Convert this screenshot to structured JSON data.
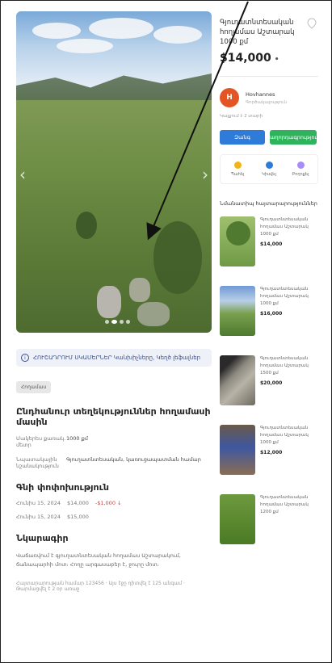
{
  "listing": {
    "title": "Գյուղատնտեսական հողամաս Աշտարակ 1000 քմ",
    "price": "$14,000",
    "price_suffix": "•",
    "notice": "ՀՈՒՇԱԴՐՈՒՄ ՍԿԱՄԵՐՆԵՐ Կանխիչները, Կեղծ լեֆալներ",
    "tag": "Հողամաս",
    "section_title": "Ընդհանուր տեղեկություններ հողամասի մասին",
    "details": [
      {
        "k": "Մակերես քառակ. մետր",
        "v": "1000 քմ"
      },
      {
        "k": "Նպատակային նշանակություն",
        "v": "Գյուղատնտեսական, կառուցապատման համար"
      }
    ],
    "price_history_title": "Գնի փոփոխություն",
    "price_history": [
      {
        "date": "Հունիս 15, 2024",
        "price": "$14,000",
        "change": "-$1,000 ↓"
      },
      {
        "date": "Հունիս 15, 2024",
        "price": "$15,000",
        "change": ""
      }
    ],
    "description_title": "Նկարագիր",
    "description": "Վաճառվում է գյուղատնտեսական հողամաս Աշտարակում, ճանապարհի մոտ։ Հողը արգասաբեր է, ջուրը մոտ։",
    "meta": "Հայտարարության համար 123456 · Այս էջը դիտվել է 125 անգամ · Թարմացվել է 2 օր առաջ"
  },
  "seller": {
    "initial": "H",
    "name": "Hovhannes",
    "subtitle": "Գործակալություն",
    "since": "Կայքում է 2 տարի"
  },
  "buttons": {
    "call": "Զանգ",
    "message": "Հաղորդագրություն"
  },
  "actions": [
    {
      "label": "Պահել",
      "color": "#f2b418"
    },
    {
      "label": "Կիսվել",
      "color": "#2f7bd9"
    },
    {
      "label": "Բողոքել",
      "color": "#a78bfa"
    }
  ],
  "similar": {
    "heading": "Նմանատիպ հայտարարություններ",
    "items": [
      {
        "title": "Գյուղատնտեսական հողամաս Աշտարակ 1000 քմ",
        "price": "$14,000"
      },
      {
        "title": "Գյուղատնտեսական հողամաս Աշտարակ 1000 քմ",
        "price": "$16,000"
      },
      {
        "title": "Գյուղատնտեսական հողամաս Աշտարակ 1500 քմ",
        "price": "$20,000"
      },
      {
        "title": "Գյուղատնտեսական հողամաս Աշտարակ 1000 քմ",
        "price": "$12,000"
      },
      {
        "title": "Գյուղատնտեսական հողամաս Աշտարակ 1200 քմ",
        "price": ""
      }
    ]
  },
  "colors": {
    "accent_blue": "#2f7bd9",
    "accent_green": "#2fb35c",
    "avatar": "#e45526"
  }
}
